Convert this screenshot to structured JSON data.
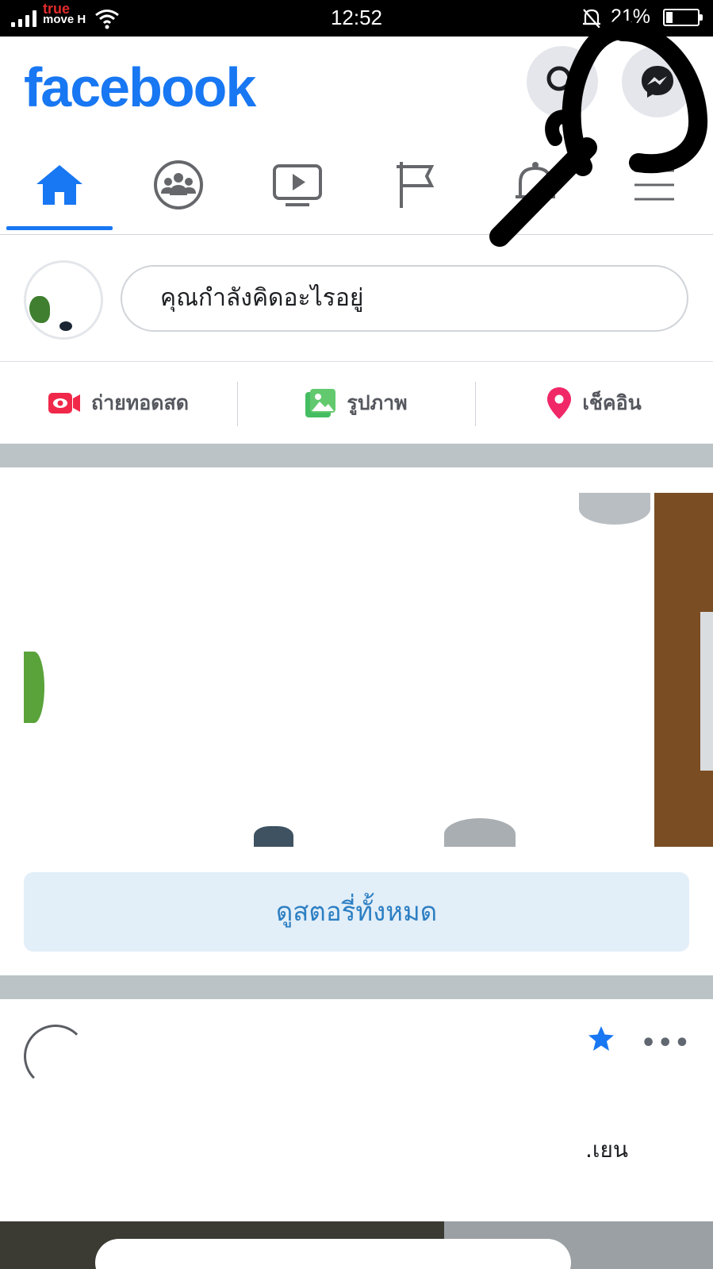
{
  "status_bar": {
    "carrier_line1": "true",
    "carrier_line2": "move H",
    "time": "12:52",
    "battery_percent": "21%",
    "battery_level": 0.21
  },
  "header": {
    "logo": "facebook",
    "search_icon": "search-icon",
    "messenger_icon": "messenger-icon"
  },
  "nav": {
    "tabs": [
      {
        "icon": "home-icon",
        "active": true
      },
      {
        "icon": "groups-icon"
      },
      {
        "icon": "watch-icon"
      },
      {
        "icon": "pages-flag-icon"
      },
      {
        "icon": "bell-icon"
      },
      {
        "icon": "menu-icon"
      }
    ]
  },
  "composer": {
    "placeholder": "คุณกำลังคิดอะไรอยู่"
  },
  "actions": {
    "live_label": "ถ่ายทอดสด",
    "photo_label": "รูปภาพ",
    "checkin_label": "เช็คอิน"
  },
  "stories": {
    "see_all_label": "ดูสตอรี่ทั้งหมด"
  },
  "post": {
    "text_fragment": ".เยน"
  },
  "colors": {
    "brand": "#1877f2",
    "live": "#f02849",
    "photo": "#45bd62",
    "checkin": "#f5533d",
    "story_button_bg": "#e2eef8",
    "story_button_text": "#2d7fc3"
  }
}
